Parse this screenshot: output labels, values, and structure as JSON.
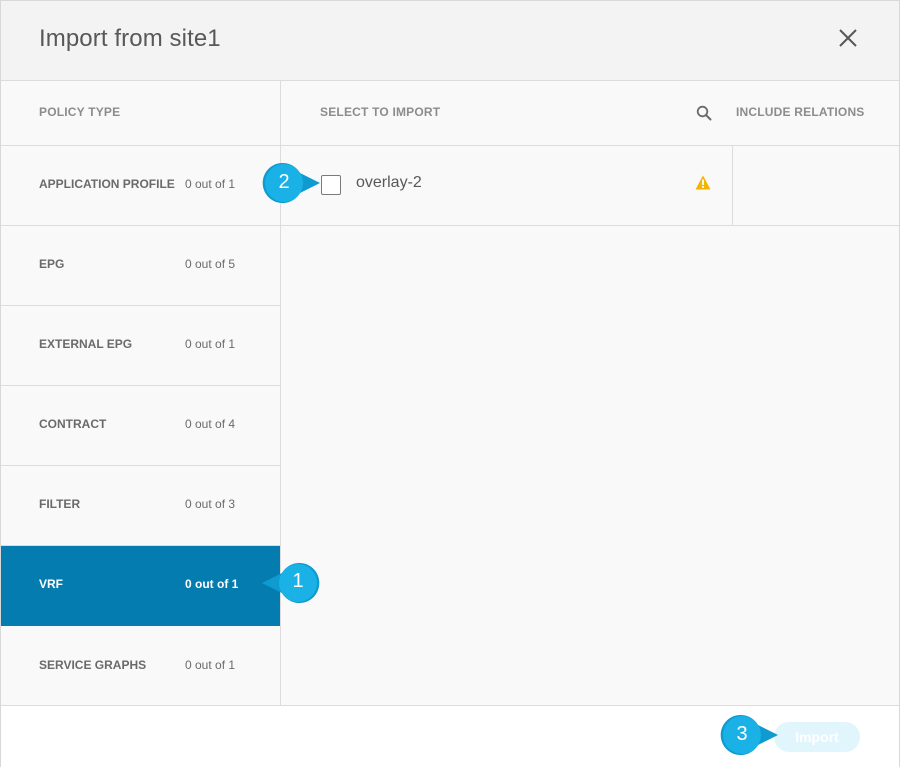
{
  "dialog": {
    "title": "Import from site1",
    "close_icon": "close-icon"
  },
  "left_panel": {
    "header": "POLICY TYPE",
    "policies": [
      {
        "name": "APPLICATION PROFILE",
        "count": "0 out of 1",
        "active": false
      },
      {
        "name": "EPG",
        "count": "0 out of 5",
        "active": false
      },
      {
        "name": "EXTERNAL EPG",
        "count": "0 out of 1",
        "active": false
      },
      {
        "name": "CONTRACT",
        "count": "0 out of 4",
        "active": false
      },
      {
        "name": "FILTER",
        "count": "0 out of 3",
        "active": false
      },
      {
        "name": "VRF",
        "count": "0 out of 1",
        "active": true
      },
      {
        "name": "SERVICE GRAPHS",
        "count": "0 out of 1",
        "active": false
      }
    ]
  },
  "right_panel": {
    "select_header": "SELECT TO IMPORT",
    "include_header": "INCLUDE RELATIONS",
    "search_icon": "search-icon",
    "items": [
      {
        "label": "overlay-2",
        "checked": false,
        "warning_icon": "warning-icon"
      }
    ]
  },
  "footer": {
    "import_label": "Import"
  },
  "callouts": [
    "1",
    "2",
    "3"
  ],
  "colors": {
    "active_row": "#047caf",
    "callout": "#19b1e6",
    "import_button": "#e1f5fd",
    "warning": "#f4b400"
  }
}
